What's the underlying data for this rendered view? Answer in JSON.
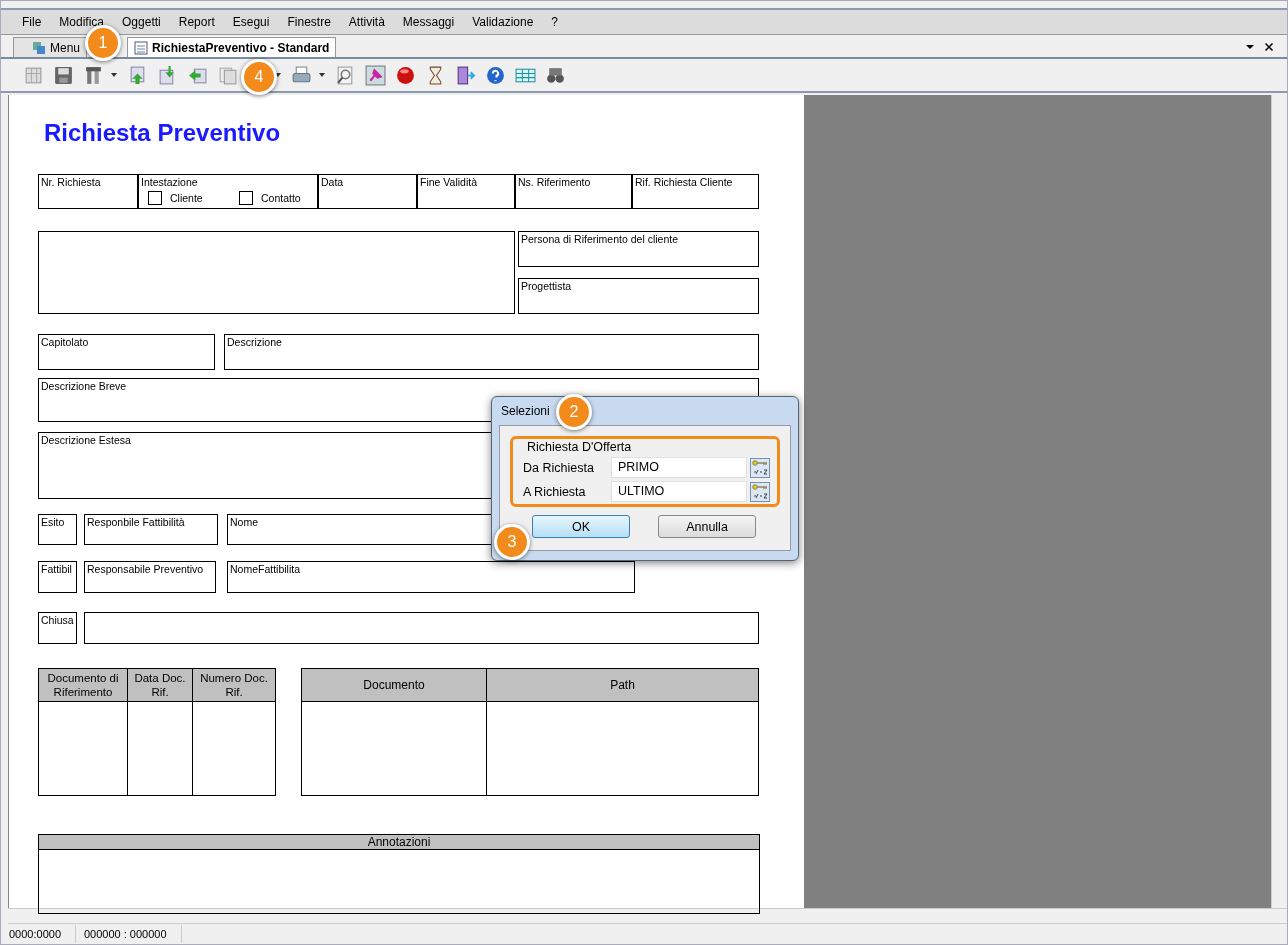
{
  "menu": [
    "File",
    "Modifica",
    "Oggetti",
    "Report",
    "Esegui",
    "Finestre",
    "Attività",
    "Messaggi",
    "Validazione",
    "?"
  ],
  "tabs": [
    {
      "label": "Menu",
      "selected": false
    },
    {
      "label": "RichiestaPreventivo - Standard",
      "selected": true
    }
  ],
  "form": {
    "title": "Richiesta Preventivo",
    "fields": [
      "Nr. Richiesta",
      "Intestazione",
      "Data",
      "Fine Validità",
      "Ns. Riferimento",
      "Rif. Richiesta Cliente",
      "Persona di Riferimento del cliente",
      "Progettista",
      "Capitolato",
      "Descrizione",
      "Descrizione Breve",
      "Descrizione Estesa",
      "Esito",
      "Responbile Fattibilità",
      "Nome",
      "Fattibil",
      "Responsabile Preventivo",
      "NomeFattibilita",
      "Chiusa"
    ],
    "checkboxes": [
      {
        "label": "Cliente",
        "checked": false
      },
      {
        "label": "Contatto",
        "checked": false
      }
    ],
    "documents_table": {
      "columns": [
        "Documento di Riferimento",
        "Data Doc. Rif.",
        "Numero Doc. Rif."
      ]
    },
    "files_table": {
      "columns": [
        "Documento",
        "Path"
      ]
    },
    "notes": {
      "header": "Annotazioni"
    }
  },
  "dialog": {
    "title": "Selezioni",
    "group": "Richiesta D'Offerta",
    "rows": [
      {
        "label": "Da Richiesta",
        "value": "PRIMO"
      },
      {
        "label": "A Richiesta",
        "value": "ULTIMO"
      }
    ],
    "buttons": [
      {
        "label": "OK",
        "focused": true
      },
      {
        "label": "Annulla",
        "focused": false
      }
    ]
  },
  "callouts": [
    "1",
    "2",
    "3",
    "4"
  ],
  "status_bar": [
    "0000:0000",
    "000000 : 000000"
  ]
}
